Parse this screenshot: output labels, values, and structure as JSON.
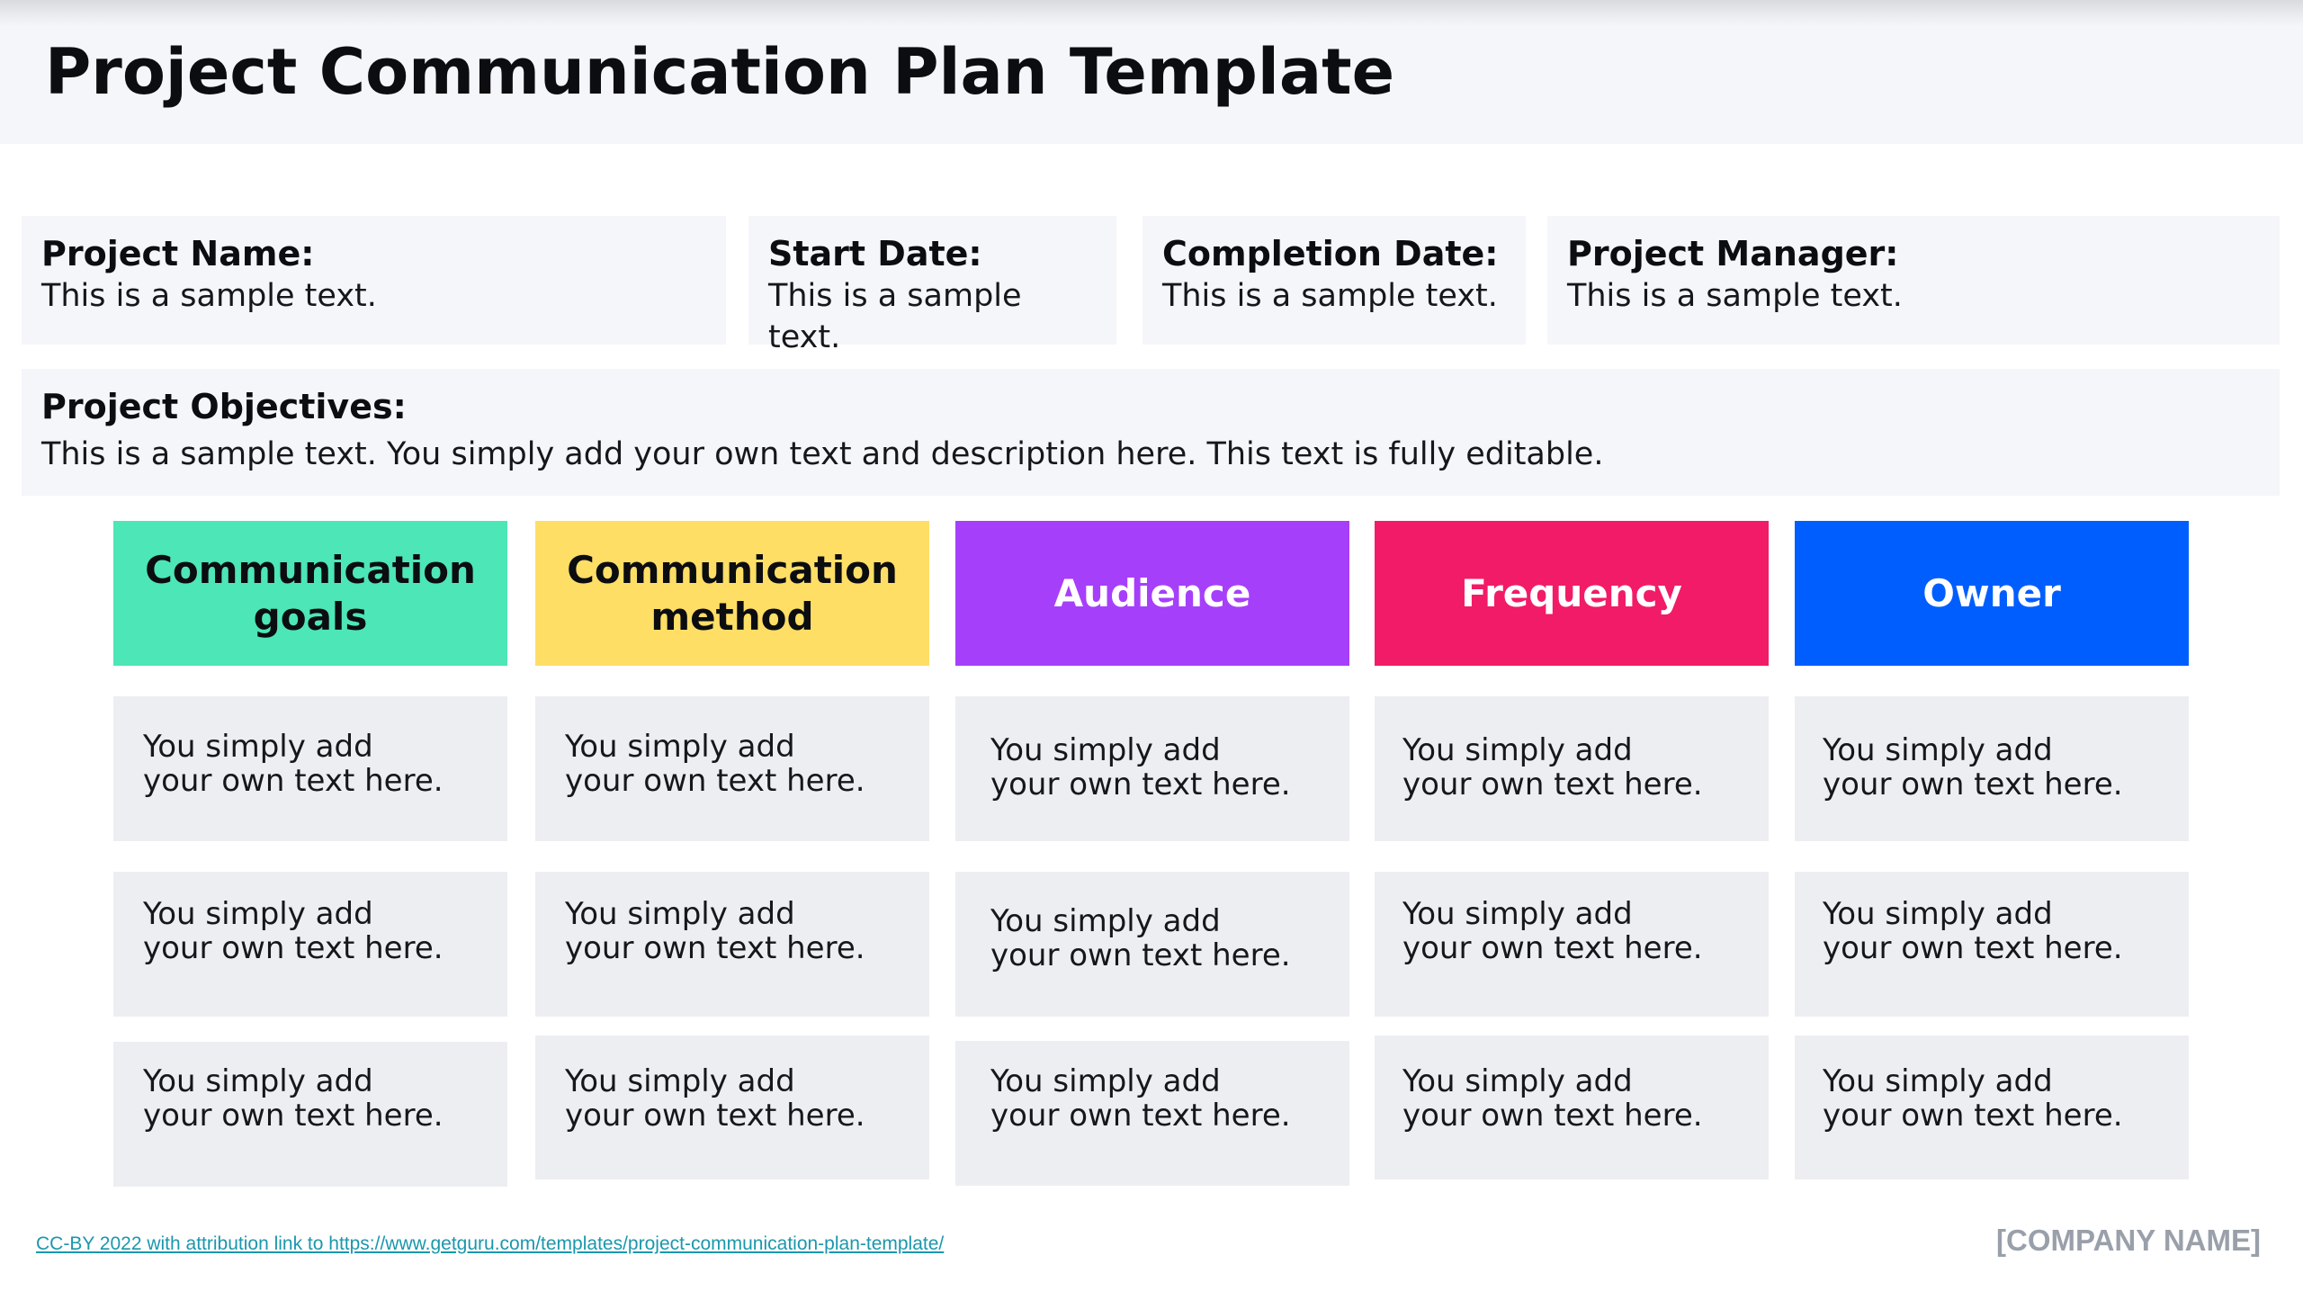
{
  "header": {
    "title": "Project Communication Plan Template"
  },
  "info": [
    {
      "label": "Project Name:",
      "value": "This is a sample text."
    },
    {
      "label": "Start Date:",
      "value": "This is a sample text."
    },
    {
      "label": "Completion Date:",
      "value": "This is a sample text."
    },
    {
      "label": "Project Manager:",
      "value": "This is a sample text."
    }
  ],
  "objectives": {
    "label": "Project Objectives:",
    "value": "This is a sample text. You simply add your own text and description here. This text is fully editable."
  },
  "columns": [
    {
      "label": "Communication goals",
      "color": "#4de6b6",
      "text_color": "#0b0d10"
    },
    {
      "label": "Communication method",
      "color": "#ffde66",
      "text_color": "#0b0d10"
    },
    {
      "label": "Audience",
      "color": "#a63ffa",
      "text_color": "#ffffff"
    },
    {
      "label": "Frequency",
      "color": "#f21b67",
      "text_color": "#ffffff"
    },
    {
      "label": "Owner",
      "color": "#005efe",
      "text_color": "#ffffff"
    }
  ],
  "rows": [
    [
      "You simply add your own text here.",
      "You simply add your own text here.",
      "You simply add your own text here.",
      "You simply add your own text here.",
      "You simply add your own text here."
    ],
    [
      "You simply add your own text here.",
      "You simply add your own text here.",
      "You simply add your own text here.",
      "You simply add your own text here.",
      "You simply add your own text here."
    ],
    [
      "You simply add your own text here.",
      "You simply add your own text here.",
      "You simply add your own text here.",
      "You simply add your own text here.",
      "You simply add your own text here."
    ]
  ],
  "footer": {
    "attribution": "CC-BY 2022 with attribution link to https://www.getguru.com/templates/project-communication-plan-template/",
    "company": "[COMPANY NAME]"
  }
}
